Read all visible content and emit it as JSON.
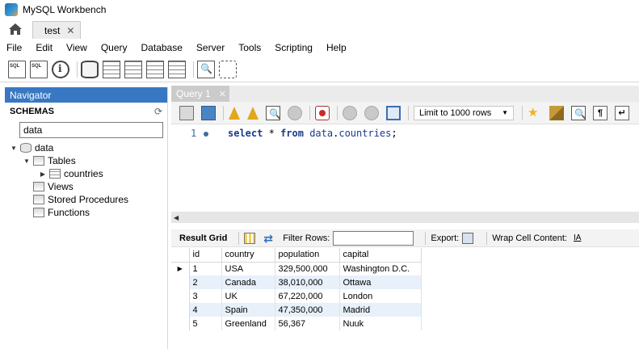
{
  "window": {
    "title": "MySQL Workbench",
    "connection_tab": "test",
    "tab_close": "✕"
  },
  "menu": [
    "File",
    "Edit",
    "View",
    "Query",
    "Database",
    "Server",
    "Tools",
    "Scripting",
    "Help"
  ],
  "navigator": {
    "header": "Navigator",
    "schemas_label": "SCHEMAS",
    "search_value": "data",
    "tree": {
      "schema": "data",
      "tables": "Tables",
      "table_item": "countries",
      "views": "Views",
      "stored_procedures": "Stored Procedures",
      "functions": "Functions"
    }
  },
  "editor": {
    "tab_label": "Query 1",
    "tab_close": "✕",
    "limit_label": "Limit to 1000 rows",
    "line_number": "1",
    "sql": {
      "kw_select": "select",
      "star": "*",
      "kw_from": "from",
      "schema": "data",
      "dot": ".",
      "table": "countries",
      "semicolon": ";"
    }
  },
  "results": {
    "result_grid_label": "Result Grid",
    "filter_rows_label": "Filter Rows:",
    "export_label": "Export:",
    "wrap_label": "Wrap Cell Content:",
    "columns": [
      "id",
      "country",
      "population",
      "capital"
    ],
    "rows": [
      [
        "1",
        "USA",
        "329,500,000",
        "Washington D.C."
      ],
      [
        "2",
        "Canada",
        "38,010,000",
        "Ottawa"
      ],
      [
        "3",
        "UK",
        "67,220,000",
        "London"
      ],
      [
        "4",
        "Spain",
        "47,350,000",
        "Madrid"
      ],
      [
        "5",
        "Greenland",
        "56,367",
        "Nuuk"
      ]
    ]
  },
  "colors": {
    "navigator_header": "#3878c3",
    "sql_keyword": "#1a3a8a",
    "row_alt": "#e8f1fa"
  }
}
